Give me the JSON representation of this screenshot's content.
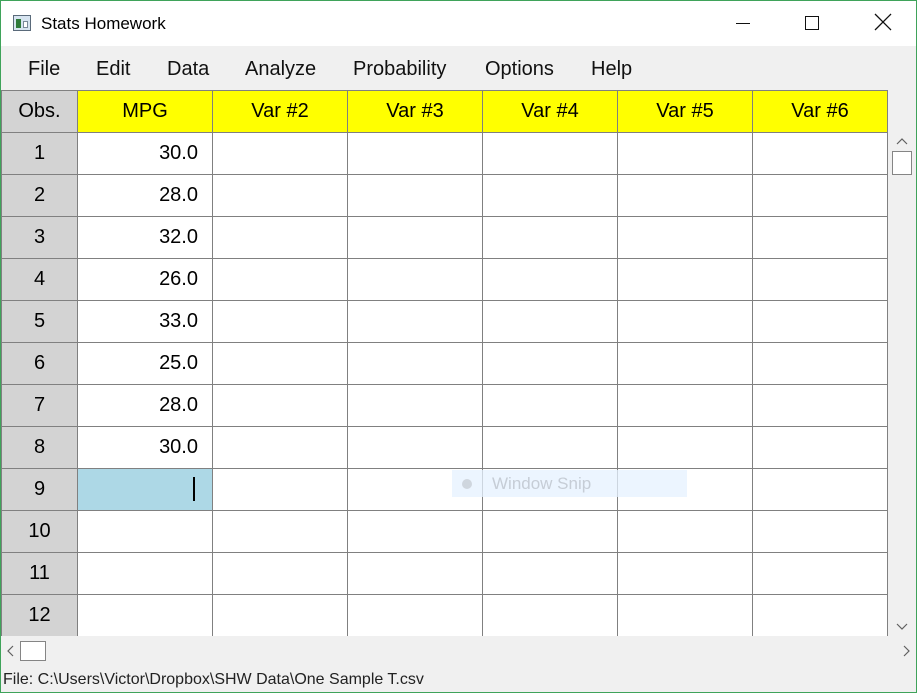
{
  "window": {
    "title": "Stats Homework"
  },
  "menu": [
    "File",
    "Edit",
    "Data",
    "Analyze",
    "Probability",
    "Options",
    "Help"
  ],
  "grid": {
    "obs_header": "Obs.",
    "columns": [
      "MPG",
      "Var #2",
      "Var #3",
      "Var #4",
      "Var #5",
      "Var #6"
    ],
    "rows": [
      {
        "obs": "1",
        "values": [
          "30.0",
          "",
          "",
          "",
          "",
          ""
        ]
      },
      {
        "obs": "2",
        "values": [
          "28.0",
          "",
          "",
          "",
          "",
          ""
        ]
      },
      {
        "obs": "3",
        "values": [
          "32.0",
          "",
          "",
          "",
          "",
          ""
        ]
      },
      {
        "obs": "4",
        "values": [
          "26.0",
          "",
          "",
          "",
          "",
          ""
        ]
      },
      {
        "obs": "5",
        "values": [
          "33.0",
          "",
          "",
          "",
          "",
          ""
        ]
      },
      {
        "obs": "6",
        "values": [
          "25.0",
          "",
          "",
          "",
          "",
          ""
        ]
      },
      {
        "obs": "7",
        "values": [
          "28.0",
          "",
          "",
          "",
          "",
          ""
        ]
      },
      {
        "obs": "8",
        "values": [
          "30.0",
          "",
          "",
          "",
          "",
          ""
        ]
      },
      {
        "obs": "9",
        "values": [
          "",
          "",
          "",
          "",
          "",
          ""
        ]
      },
      {
        "obs": "10",
        "values": [
          "",
          "",
          "",
          "",
          "",
          ""
        ]
      },
      {
        "obs": "11",
        "values": [
          "",
          "",
          "",
          "",
          "",
          ""
        ]
      },
      {
        "obs": "12",
        "values": [
          "",
          "",
          "",
          "",
          "",
          ""
        ]
      }
    ],
    "selected": {
      "row": 8,
      "col": 0
    }
  },
  "overlay": {
    "label": "Window Snip"
  },
  "status": {
    "text": "File: C:\\Users\\Victor\\Dropbox\\SHW Data\\One Sample T.csv"
  },
  "colors": {
    "header_bg": "#ffff00",
    "obs_bg": "#d3d3d3",
    "selected_bg": "#add8e6",
    "border": "#808080"
  }
}
